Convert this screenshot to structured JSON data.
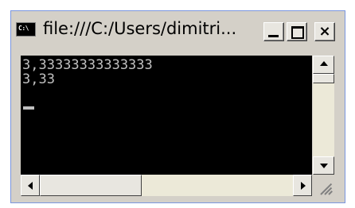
{
  "window": {
    "title": "file:///C:/Users/dimitri...",
    "icon_text": "C:\\",
    "controls": {
      "minimize": "minimize-icon",
      "maximize": "maximize-icon",
      "close": "×"
    }
  },
  "console": {
    "lines": [
      "3,33333333333333",
      "3,33"
    ],
    "text_color": "#c0c0c0",
    "background": "#000000"
  },
  "icons": [
    "console-app-icon",
    "minimize-icon",
    "maximize-icon",
    "close-icon",
    "scroll-up-arrow-icon",
    "scroll-down-arrow-icon",
    "scroll-left-arrow-icon",
    "scroll-right-arrow-icon",
    "resize-grip-icon"
  ]
}
